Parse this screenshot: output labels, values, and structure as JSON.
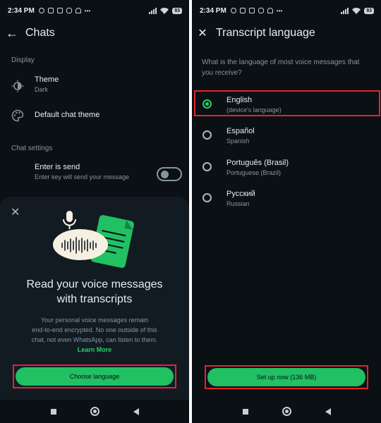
{
  "colors": {
    "background": "#0b1014",
    "sheet": "#121b22",
    "accent_green": "#21c063",
    "highlight_red": "#e0262c",
    "secondary_text": "#8696a0"
  },
  "left": {
    "status": {
      "time": "2:34 PM",
      "icons": [
        "alarm-icon",
        "gallery-icon",
        "linkedin-icon",
        "instagram-icon",
        "snapchat-icon",
        "more-icon"
      ],
      "more": "•••",
      "battery": "93"
    },
    "appbar": {
      "back": "←",
      "title": "Chats"
    },
    "display_label": "Display",
    "theme": {
      "label": "Theme",
      "value": "Dark"
    },
    "default_chat_theme": {
      "label": "Default chat theme"
    },
    "chat_settings_label": "Chat settings",
    "enter_is_send": {
      "label": "Enter is send",
      "desc": "Enter key will send your message",
      "enabled": false
    },
    "sheet": {
      "close": "✕",
      "title_line1": "Read your voice messages",
      "title_line2": "with transcripts",
      "desc_line1": "Your personal voice messages remain",
      "desc_line2": "end-to-end encrypted. No one outside of this",
      "desc_line3": "chat, not even WhatsApp, can listen to them.",
      "learn_more": "Learn More",
      "button": "Choose language"
    }
  },
  "right": {
    "status": {
      "time": "2:34 PM",
      "more": "•••",
      "battery": "93"
    },
    "appbar": {
      "close": "✕",
      "title": "Transcript language"
    },
    "question": "What is the language of most voice messages that you receive?",
    "languages": [
      {
        "name": "English",
        "sub": "(device's language)",
        "selected": true
      },
      {
        "name": "Español",
        "sub": "Spanish",
        "selected": false
      },
      {
        "name": "Português (Brasil)",
        "sub": "Portuguese (Brazil)",
        "selected": false
      },
      {
        "name": "Русский",
        "sub": "Russian",
        "selected": false
      }
    ],
    "button": "Set up now (136 MB)"
  }
}
